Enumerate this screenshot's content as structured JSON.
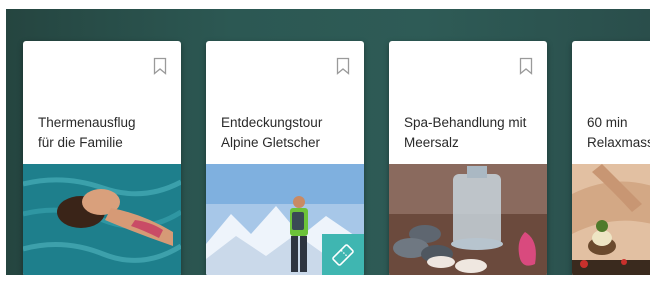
{
  "cards": [
    {
      "title_line1": "Thermenausflug",
      "title_line2": "für die Familie",
      "image": "woman-floating-thermal-pool"
    },
    {
      "title_line1": "Entdeckungstour",
      "title_line2": "Alpine Gletscher",
      "image": "hiker-glacier-mountains",
      "badge_icon": "ticket-icon"
    },
    {
      "title_line1": "Spa-Behandlung mit",
      "title_line2": "Meersalz",
      "image": "spa-stones-candles-salt"
    },
    {
      "title_line1": "60 min",
      "title_line2": "Relaxmass",
      "image": "massage-herbal-stamps"
    }
  ],
  "icons": {
    "bookmark": "bookmark-icon"
  },
  "colors": {
    "background": "#2c5853",
    "card": "#ffffff",
    "badge": "#3fb6b1"
  }
}
